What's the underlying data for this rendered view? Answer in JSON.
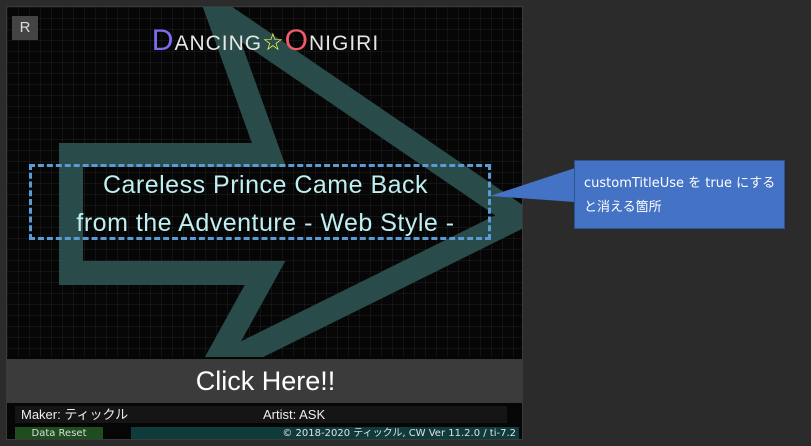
{
  "reset_key": "R",
  "logo": {
    "d_cap": "D",
    "d_rest": "ANCING",
    "star": "☆",
    "o_cap": "O",
    "o_rest": "NIGIRI",
    "colors": {
      "d": "#7b6cf0",
      "o": "#f05a6a",
      "star": "#ffff4d"
    }
  },
  "song_title": {
    "line1": "Careless Prince Came Back",
    "line2": "from the Adventure - Web Style -"
  },
  "start_button": "Click Here!!",
  "credits": {
    "maker": "Maker: ティックル",
    "artist": "Artist: ASK"
  },
  "footer": {
    "data_reset": "Data Reset",
    "copyright": "© 2018-2020 ティックル, CW Ver 11.2.0 / ti-7.2"
  },
  "callout": {
    "text": "customTitleUse を true にすると消える箇所",
    "color": "#4472c4"
  },
  "icons": [
    "arrow-background",
    "dashed-highlight-box"
  ]
}
